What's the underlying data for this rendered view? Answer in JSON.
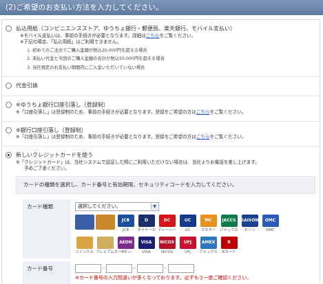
{
  "header": {
    "title": "(2)ご希望のお支払い方法を入力してください。"
  },
  "options": {
    "bank": {
      "title": "払込用紙（コンビニエンスストア、ゆうちょ銀行・郵便局、楽天銀行、モバイル支払い）",
      "note1_pre": "※モバイル支払いは、事前の手続きが必要となります。詳細は",
      "note1_link": "こちら",
      "note1_post": "をご覧ください。",
      "note2": "※下記の場合、「払込用紙」はご利用できません。",
      "cond1": "1. 初めてのご注文でご購入金額が税込20,000円を超える場合",
      "cond2": "2. 未払い代金と今回のご購入金額の合計が税込50,000円を超える場合",
      "cond3": "3. 当社規定のお支払い期間内にご入金いただいていない場合"
    },
    "cod": {
      "title": "代金引換"
    },
    "yucho": {
      "title": "※ゆうちょ銀行口座引落し（登録制）",
      "note_pre": "※「口座引落し」は登録制のため、事前の手続きが必要となります。登録をご希望の方は",
      "note_link": "こちら",
      "note_post": "をご覧ください。"
    },
    "ginko": {
      "title": "※銀行口座引落し（登録制）",
      "note_pre": "※「口座引落し」は登録制のため、事前の手続きが必要となります。登録をご希望の方は",
      "note_link": "こちら",
      "note_post": "をご覧ください。"
    },
    "card": {
      "title": "新しいクレジットカードを使う",
      "note1": "※「クレジットカード」は、当社システムで認証した際にご利用いただけない場合は、当社よりお電話を差し上げます。",
      "note2": "予めご了承ください。",
      "intro": "カードの種類を選択し、カード番号と有効期限、セキュリティコードを入力してください。",
      "type_label": "カード種類",
      "select_value": "選択してください。",
      "number_label": "カード番号",
      "warning": "※カード番号の入力間違いが多くなっております。必ずもう一度ご確認ください。"
    }
  },
  "brands_row1": [
    {
      "label": "",
      "logo": "",
      "color": "#3a5fa8",
      "icon": "famima-card-logo"
    },
    {
      "label": "",
      "logo": "",
      "color": "#c9882c",
      "icon": "premium-card-logo"
    },
    {
      "label": "JCB",
      "logo": "JCB",
      "color": "#1d4f9c",
      "icon": "jcb-logo"
    },
    {
      "label": "ダイナース",
      "logo": "D",
      "color": "#1a2f6e",
      "icon": "diners-logo"
    },
    {
      "label": "ディーシー",
      "logo": "DC",
      "color": "#d7141a",
      "icon": "dc-logo"
    },
    {
      "label": "UC",
      "logo": "UC",
      "color": "#123a8a",
      "icon": "uc-logo"
    },
    {
      "label": "マスター",
      "logo": "MC",
      "color": "#e8901e",
      "icon": "mastercard-logo"
    },
    {
      "label": "ジャックス",
      "logo": "JACCS",
      "color": "#0f7a4a",
      "icon": "jaccs-logo"
    },
    {
      "label": "セゾン",
      "logo": "SAISON",
      "color": "#1b3f8f",
      "icon": "saison-logo"
    },
    {
      "label": "OMC",
      "logo": "OMC",
      "color": "#2b5bb5",
      "icon": "omc-logo"
    }
  ],
  "brands_row2": [
    {
      "label": "ファンケル",
      "logo": "",
      "color": "#d9a441",
      "icon": "fancl-card-logo"
    },
    {
      "label": "プレミアムカード",
      "logo": "",
      "color": "#cfae62",
      "icon": "premium-gold-card-logo"
    },
    {
      "label": "イオン",
      "logo": "AEON",
      "color": "#7c2c8c",
      "icon": "aeon-logo"
    },
    {
      "label": "VISA",
      "logo": "VISA",
      "color": "#1a1f71",
      "icon": "visa-logo"
    },
    {
      "label": "NICOS",
      "logo": "NICOS",
      "color": "#b8102a",
      "icon": "nicos-logo"
    },
    {
      "label": "UFJ",
      "logo": "UFJ",
      "color": "#c41230",
      "icon": "ufj-logo"
    },
    {
      "label": "アメックス",
      "logo": "AMEX",
      "color": "#2e77bc",
      "icon": "amex-logo"
    },
    {
      "label": "Rカード",
      "logo": "R",
      "color": "#bf0000",
      "icon": "rakuten-card-logo"
    }
  ]
}
